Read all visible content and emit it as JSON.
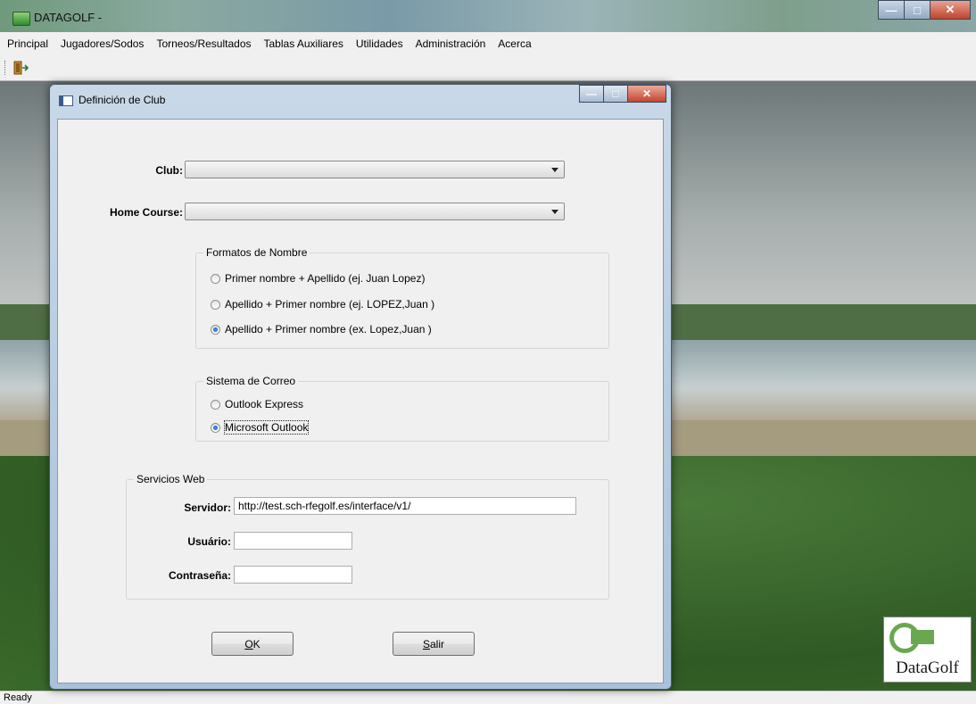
{
  "app": {
    "title": "DATAGOLF  -"
  },
  "menu": [
    "Principal",
    "Jugadores/Sodos",
    "Torneos/Resultados",
    "Tablas Auxiliares",
    "Utilidades",
    "Administración",
    "Acerca"
  ],
  "dialog": {
    "title": "Definición de Club",
    "club_label": "Club:",
    "club_value": "",
    "home_course_label": "Home Course:",
    "home_course_value": "",
    "name_format": {
      "title": "Formatos de Nombre",
      "options": [
        {
          "label": "Primer nombre + Apellido (ej. Juan Lopez)",
          "checked": false
        },
        {
          "label": "Apellido + Primer nombre  (ej. LOPEZ,Juan )",
          "checked": false
        },
        {
          "label": "Apellido + Primer nombre  (ex. Lopez,Juan )",
          "checked": true
        }
      ]
    },
    "mail": {
      "title": "Sistema de Correo",
      "options": [
        {
          "label": "Outlook Express",
          "checked": false
        },
        {
          "label": "Microsoft Outlook",
          "checked": true
        }
      ]
    },
    "web": {
      "title": "Servicios Web",
      "server_label": "Servidor:",
      "server_value": "http://test.sch-rfegolf.es/interface/v1/",
      "user_label": "Usuário:",
      "user_value": "",
      "password_label": "Contraseña:",
      "password_value": ""
    },
    "ok": {
      "hotkey": "O",
      "rest": "K"
    },
    "exit": {
      "hotkey": "S",
      "rest": "alir"
    }
  },
  "logo_text": "DataGolf",
  "status": "Ready"
}
